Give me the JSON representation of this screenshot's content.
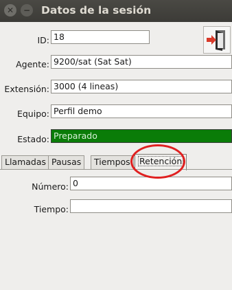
{
  "window": {
    "title": "Datos de la sesión"
  },
  "fields": {
    "id": {
      "label": "ID:",
      "value": "18"
    },
    "agente": {
      "label": "Agente:",
      "value": "9200/sat (Sat Sat)"
    },
    "extension": {
      "label": "Extensión:",
      "value": "3000 (4 lineas)"
    },
    "equipo": {
      "label": "Equipo:",
      "value": "Perfil demo"
    },
    "estado": {
      "label": "Estado:",
      "value": "Preparado",
      "color": "#0a7c08"
    }
  },
  "tabs": [
    {
      "label": "Llamadas"
    },
    {
      "label": "Pausas"
    },
    {
      "label": "Tiempos"
    },
    {
      "label": "Retención",
      "active": true
    }
  ],
  "retencion": {
    "numero": {
      "label": "Número:",
      "value": "0"
    },
    "tiempo": {
      "label": "Tiempo:",
      "value": ""
    }
  },
  "icons": {
    "close": "close-icon",
    "minimize": "minimize-icon",
    "exit": "exit-door-icon"
  },
  "annotation_color": "#e02020"
}
